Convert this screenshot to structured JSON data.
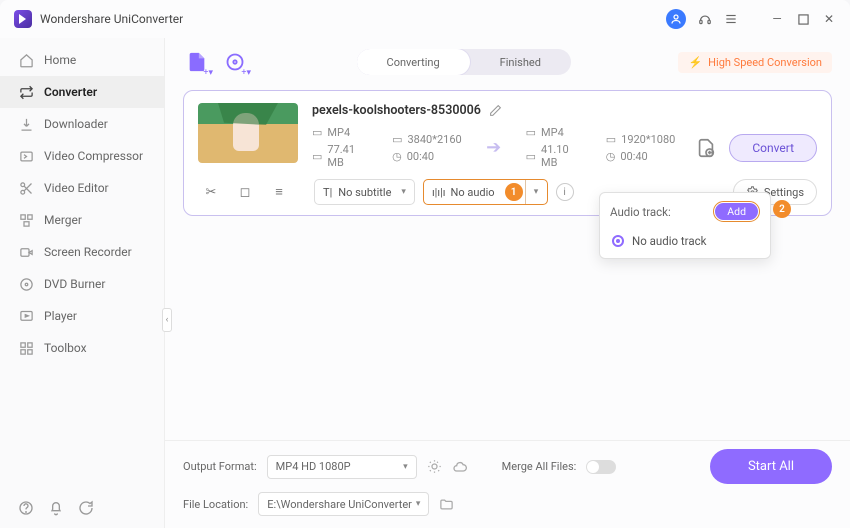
{
  "app_title": "Wondershare UniConverter",
  "sidebar": {
    "items": [
      {
        "label": "Home"
      },
      {
        "label": "Converter"
      },
      {
        "label": "Downloader"
      },
      {
        "label": "Video Compressor"
      },
      {
        "label": "Video Editor"
      },
      {
        "label": "Merger"
      },
      {
        "label": "Screen Recorder"
      },
      {
        "label": "DVD Burner"
      },
      {
        "label": "Player"
      },
      {
        "label": "Toolbox"
      }
    ]
  },
  "tabs": {
    "converting": "Converting",
    "finished": "Finished"
  },
  "high_speed": "High Speed Conversion",
  "item": {
    "filename": "pexels-koolshooters-8530006",
    "src_format": "MP4",
    "src_res": "3840*2160",
    "src_size": "77.41 MB",
    "src_dur": "00:40",
    "dst_format": "MP4",
    "dst_res": "1920*1080",
    "dst_size": "41.10 MB",
    "dst_dur": "00:40",
    "subtitle": "No subtitle",
    "audio": "No audio",
    "settings_label": "Settings",
    "convert_label": "Convert"
  },
  "dropdown": {
    "title": "Audio track:",
    "add": "Add",
    "option": "No audio track"
  },
  "callouts": {
    "one": "1",
    "two": "2"
  },
  "footer": {
    "output_format_label": "Output Format:",
    "output_format_value": "MP4 HD 1080P",
    "file_location_label": "File Location:",
    "file_location_value": "E:\\Wondershare UniConverter",
    "merge_label": "Merge All Files:",
    "start_all": "Start All"
  }
}
